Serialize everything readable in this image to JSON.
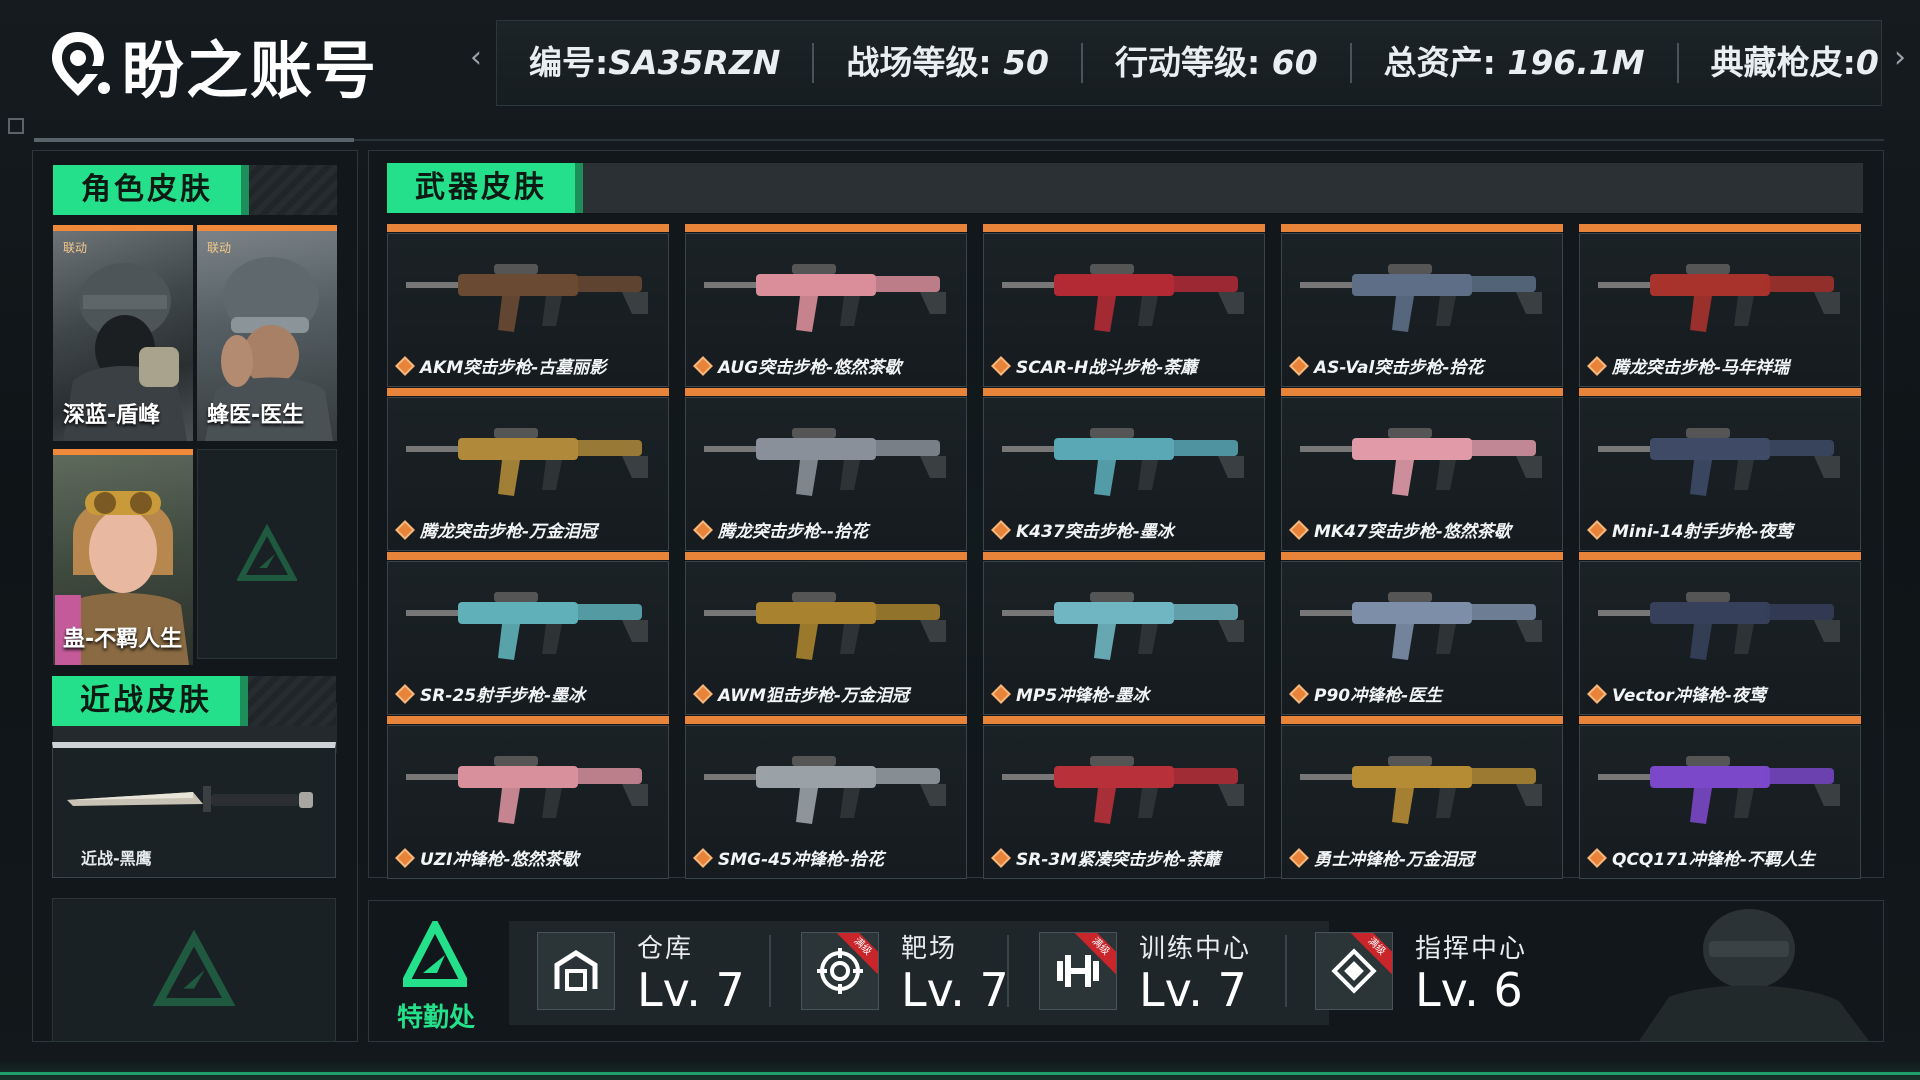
{
  "header": {
    "title": "盼之账号",
    "left_arrow": "‹",
    "right_arrow": "›",
    "stats": [
      {
        "label": "编号:",
        "value": "SA35RZN"
      },
      {
        "label": "战场等级:",
        "value": "50"
      },
      {
        "label": "行动等级:",
        "value": "60"
      },
      {
        "label": "总资产:",
        "value": "196.1M"
      },
      {
        "label": "典藏枪皮:",
        "value": "0"
      }
    ]
  },
  "character_section": {
    "title": "角色皮肤",
    "skins": [
      {
        "name": "深蓝-盾峰",
        "badge": "联动"
      },
      {
        "name": "蜂医-医生",
        "badge": "联动"
      },
      {
        "name": "蛊-不羁人生",
        "badge": ""
      }
    ]
  },
  "melee_section": {
    "title": "近战皮肤",
    "skins": [
      {
        "name": "近战-黑鹰"
      }
    ]
  },
  "weapon_section": {
    "title": "武器皮肤",
    "weapons": [
      {
        "name": "AKM突击步枪-古墓丽影",
        "color": "#6b4a33"
      },
      {
        "name": "AUG突击步枪-悠然茶歇",
        "color": "#d98e9a"
      },
      {
        "name": "SCAR-H战斗步枪-荼蘼",
        "color": "#b32a35"
      },
      {
        "name": "AS-Val突击步枪-拾花",
        "color": "#5d6e86"
      },
      {
        "name": "腾龙突击步枪-马年祥瑞",
        "color": "#a8322c"
      },
      {
        "name": "腾龙突击步枪-万金泪冠",
        "color": "#b08a3a"
      },
      {
        "name": "腾龙突击步枪--拾花",
        "color": "#8a9099"
      },
      {
        "name": "K437突击步枪-墨冰",
        "color": "#5aa8b6"
      },
      {
        "name": "MK47突击步枪-悠然茶歇",
        "color": "#e09aa8"
      },
      {
        "name": "Mini-14射手步枪-夜莺",
        "color": "#3e4a66"
      },
      {
        "name": "SR-25射手步枪-墨冰",
        "color": "#5fb0b8"
      },
      {
        "name": "AWM狙击步枪-万金泪冠",
        "color": "#a8822e"
      },
      {
        "name": "MP5冲锋枪-墨冰",
        "color": "#6fb6c2"
      },
      {
        "name": "P90冲锋枪-医生",
        "color": "#7d8ea8"
      },
      {
        "name": "Vector冲锋枪-夜莺",
        "color": "#36405a"
      },
      {
        "name": "UZI冲锋枪-悠然茶歇",
        "color": "#d7909c"
      },
      {
        "name": "SMG-45冲锋枪-拾花",
        "color": "#9aa2a8"
      },
      {
        "name": "SR-3M紧凑突击步枪-荼蘼",
        "color": "#b8303a"
      },
      {
        "name": "勇士冲锋枪-万金泪冠",
        "color": "#b58b34"
      },
      {
        "name": "QCQ171冲锋枪-不羁人生",
        "color": "#7a48c8"
      }
    ]
  },
  "bottom_bar": {
    "label": "特勤处",
    "facilities": [
      {
        "name": "仓库",
        "level": "Lv. 7",
        "icon": "warehouse-icon",
        "ribbon": ""
      },
      {
        "name": "靶场",
        "level": "Lv. 7",
        "icon": "target-icon",
        "ribbon": "满级"
      },
      {
        "name": "训练中心",
        "level": "Lv. 7",
        "icon": "dumbbell-icon",
        "ribbon": "满级"
      },
      {
        "name": "指挥中心",
        "level": "Lv. 6",
        "icon": "command-icon",
        "ribbon": "满级"
      }
    ]
  },
  "colors": {
    "accent_green": "#25e08a",
    "accent_orange": "#e8843a",
    "ribbon_red": "#c8262a"
  }
}
